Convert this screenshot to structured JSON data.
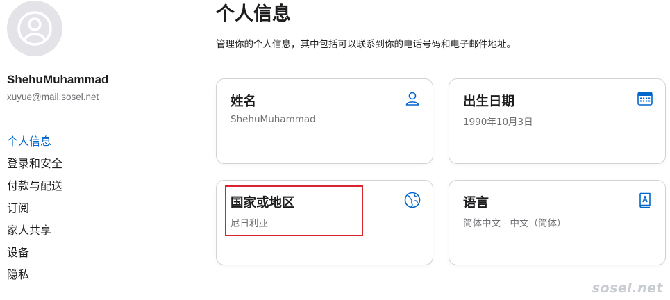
{
  "user": {
    "name": "ShehuMuhammad",
    "email": "xuyue@mail.sosel.net"
  },
  "sidebar": {
    "items": [
      {
        "label": "个人信息",
        "active": true
      },
      {
        "label": "登录和安全"
      },
      {
        "label": "付款与配送"
      },
      {
        "label": "订阅"
      },
      {
        "label": "家人共享"
      },
      {
        "label": "设备"
      },
      {
        "label": "隐私"
      }
    ]
  },
  "main": {
    "title": "个人信息",
    "description": "管理你的个人信息，其中包括可以联系到你的电话号码和电子邮件地址。",
    "cards": [
      {
        "title": "姓名",
        "value": "ShehuMuhammad",
        "icon": "person-icon"
      },
      {
        "title": "出生日期",
        "value": "1990年10月3日",
        "icon": "calendar-icon"
      },
      {
        "title": "国家或地区",
        "value": "尼日利亚",
        "icon": "globe-icon"
      },
      {
        "title": "语言",
        "value": "简体中文 - 中文（简体）",
        "icon": "language-book-icon"
      }
    ]
  },
  "colors": {
    "accent": "#0066cc",
    "highlight": "#d9232e",
    "secondary_text": "#6e6e73"
  },
  "watermark": "sosel.net"
}
